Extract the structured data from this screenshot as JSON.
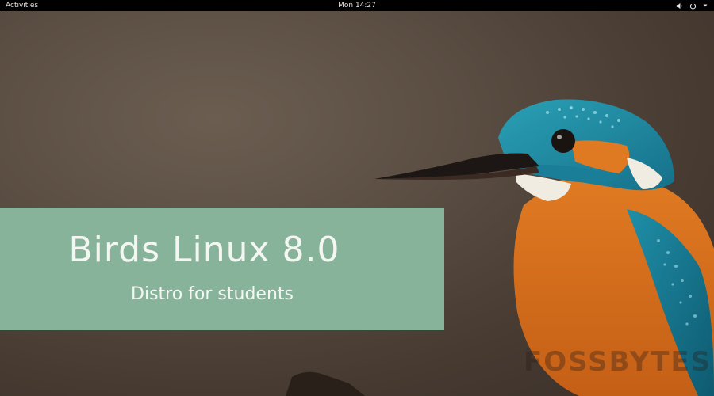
{
  "topbar": {
    "activities_label": "Activities",
    "clock_label": "Mon 14:27",
    "volume_icon": "volume-icon",
    "power_icon": "power-icon",
    "menu_arrow_icon": "dropdown-arrow-icon"
  },
  "wallpaper": {
    "banner": {
      "title": "Birds Linux 8.0",
      "subtitle": "Distro for students"
    },
    "watermark": "FOSSBYTES",
    "image": "kingfisher-bird",
    "colors": {
      "background": "#4a3f36",
      "banner": "#86b39a",
      "bird_orange": "#d9731f",
      "bird_blue": "#1f8fa8"
    }
  }
}
